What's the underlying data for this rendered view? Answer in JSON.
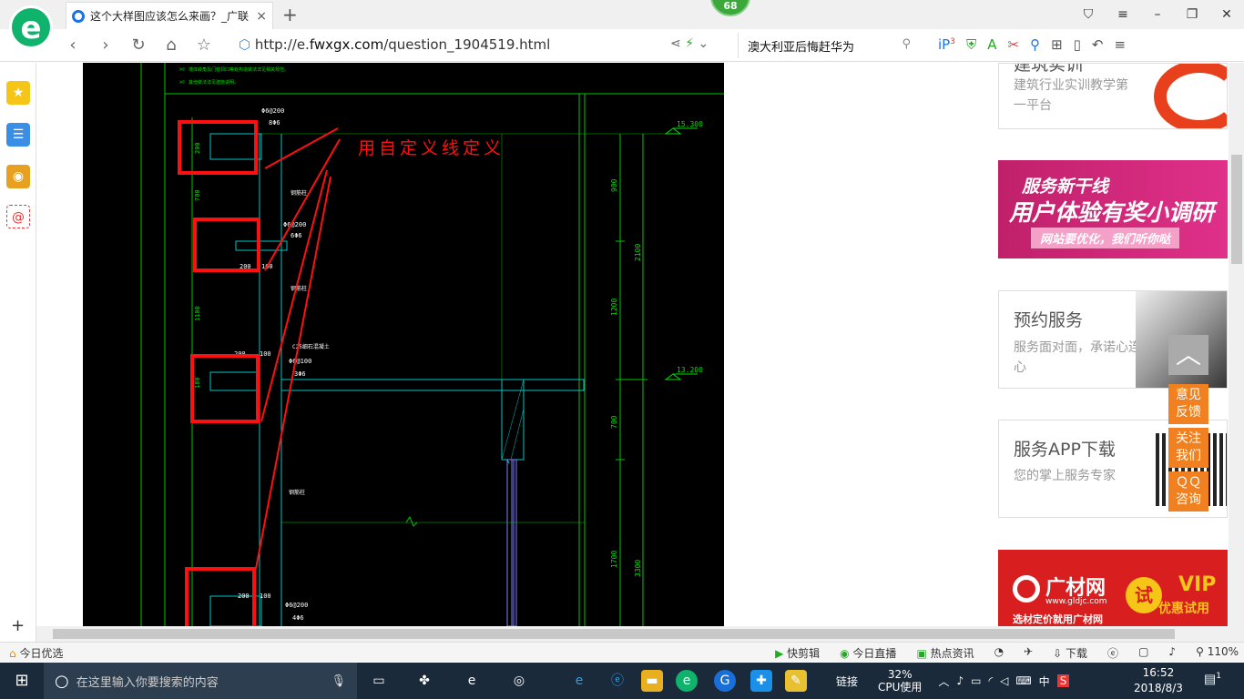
{
  "browser": {
    "logo_letter": "e",
    "tab_title": "这个大样图应该怎么来画？_广联",
    "tab_close": "×",
    "new_tab": "+",
    "badge_count": "68",
    "url_prefix": "http://e.",
    "url_domain": "fwxgx.com",
    "url_path": "/question_1904519.html",
    "search_text": "澳大利亚后悔赶华为",
    "ext_badge": "3",
    "zoom": "110%"
  },
  "cad": {
    "annotation": "用自定义线定义",
    "top_notes": [
      "※ 墙体转角及门窗洞口等处构造做法详见相关规范。",
      "※ 其他做法详见建施说明。"
    ],
    "elevations": [
      "15.300",
      "13.200"
    ],
    "right_dims": [
      "900",
      "2100",
      "1200",
      "700",
      "1700",
      "3300"
    ],
    "left_dims": [
      "200",
      "700",
      "1100",
      "180"
    ],
    "labels": {
      "a": "Φ6@200",
      "b": "8Φ6",
      "c": "钢筋柱",
      "d": "Φ6@200",
      "e": "6Φ6",
      "f": "200",
      "g": "100",
      "h": "钢筋柱",
      "i": "C25细石混凝土",
      "j": "200",
      "k": "100",
      "l": "Φ6@100",
      "m": "3Φ6",
      "n": "钢筋柱",
      "o": "200",
      "p": "100",
      "q": "Φ6@200",
      "r": "4Φ6"
    }
  },
  "right_panel": {
    "card1": {
      "title": "建筑实训",
      "sub": "建筑行业实训教学第一平台"
    },
    "banner1": {
      "line1": "服务新干线",
      "line2": "用户体验有奖小调研",
      "line3": "网站要优化，我们听你哒"
    },
    "card2": {
      "title": "预约服务",
      "sub": "服务面对面，承诺心连心"
    },
    "card3": {
      "title": "服务APP下载",
      "sub": "您的掌上服务专家"
    },
    "banner2": {
      "brand": "广材网",
      "url": "www.gldjc.com",
      "try": "试",
      "vip": "VIP",
      "vip_sub": "优惠试用",
      "slogan": "选材定价就用广材网"
    }
  },
  "float_buttons": [
    "意见反馈",
    "关注我们",
    "ＱＱ咨询"
  ],
  "statusbar": {
    "left": "今日优选",
    "items": [
      "快剪辑",
      "今日直播",
      "热点资讯",
      "下载",
      "110%"
    ]
  },
  "taskbar": {
    "search_placeholder": "在这里输入你要搜索的内容",
    "tray_link": "链接",
    "cpu_value": "32%",
    "cpu_label": "CPU使用",
    "ime": "中",
    "time": "16:52",
    "date": "2018/8/3",
    "notif_count": "1"
  },
  "colors": {
    "cad_bg": "#000000",
    "cad_cyan": "#00c8c8",
    "cad_green": "#00e000",
    "cad_red": "#ff1010",
    "accent_orange": "#f08020",
    "browser_green": "#10b36b"
  }
}
